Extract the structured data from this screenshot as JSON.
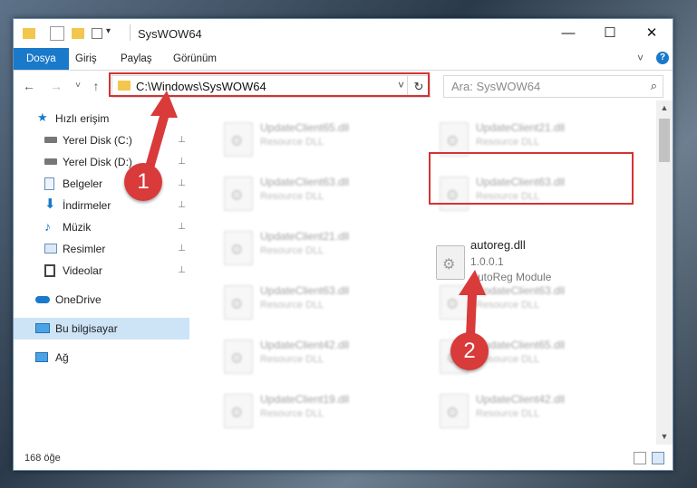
{
  "window": {
    "title": "SysWOW64",
    "controls": [
      "—",
      "☐",
      "✕"
    ]
  },
  "ribbon": {
    "tabs": [
      "Dosya",
      "Giriş",
      "Paylaş",
      "Görünüm"
    ],
    "collapse_icon": "˅",
    "help_icon": "?"
  },
  "navigation": {
    "back": "←",
    "forward": "→",
    "recent": "˅",
    "up": "↑",
    "address": "C:\\Windows\\SysWOW64",
    "dropdown": "˅",
    "refresh": "↻"
  },
  "search": {
    "placeholder": "Ara: SysWOW64",
    "icon": "⌕"
  },
  "sidebar": {
    "items": [
      {
        "label": "Hızlı erişim",
        "icon": "star-icon",
        "pinned": false
      },
      {
        "label": "Yerel Disk (C:)",
        "icon": "drive-icon",
        "pinned": true
      },
      {
        "label": "Yerel Disk (D:)",
        "icon": "drive-icon",
        "pinned": true
      },
      {
        "label": "Belgeler",
        "icon": "documents-icon",
        "pinned": true
      },
      {
        "label": "İndirmeler",
        "icon": "download-icon",
        "pinned": true
      },
      {
        "label": "Müzik",
        "icon": "music-icon",
        "pinned": true
      },
      {
        "label": "Resimler",
        "icon": "pictures-icon",
        "pinned": true
      },
      {
        "label": "Videolar",
        "icon": "videos-icon",
        "pinned": true
      },
      {
        "label": "OneDrive",
        "icon": "cloud-icon",
        "pinned": false
      },
      {
        "label": "Bu bilgisayar",
        "icon": "computer-icon",
        "pinned": false
      },
      {
        "label": "Ağ",
        "icon": "network-icon",
        "pinned": false
      }
    ],
    "pin_glyph": "📌"
  },
  "files": {
    "left": [
      {
        "name": "UpdateClient65.dll",
        "type": "Resource DLL"
      },
      {
        "name": "UpdateClient63.dll",
        "type": "Resource DLL"
      },
      {
        "name": "UpdateClient21.dll",
        "type": "Resource DLL"
      },
      {
        "name": "UpdateClient63.dll",
        "type": "Resource DLL"
      },
      {
        "name": "UpdateClient42.dll",
        "type": "Resource DLL"
      },
      {
        "name": "UpdateClient19.dll",
        "type": "Resource DLL"
      }
    ],
    "right": [
      {
        "name": "UpdateClient21.dll",
        "type": "Resource DLL"
      },
      {
        "name": "UpdateClient63.dll",
        "type": "Resource DLL"
      },
      {
        "name": "UpdateClient63.dll",
        "type": "Resource DLL"
      },
      {
        "name": "UpdateClient65.dll",
        "type": "Resource DLL"
      },
      {
        "name": "UpdateClient42.dll",
        "type": "Resource DLL"
      }
    ],
    "highlighted": {
      "name": "autoreg.dll",
      "version": "1.0.0.1",
      "description": "AutoReg Module"
    }
  },
  "status": {
    "count": "168 öğe"
  },
  "annotations": {
    "step1": "1",
    "step2": "2",
    "color": "#d93a3a"
  }
}
